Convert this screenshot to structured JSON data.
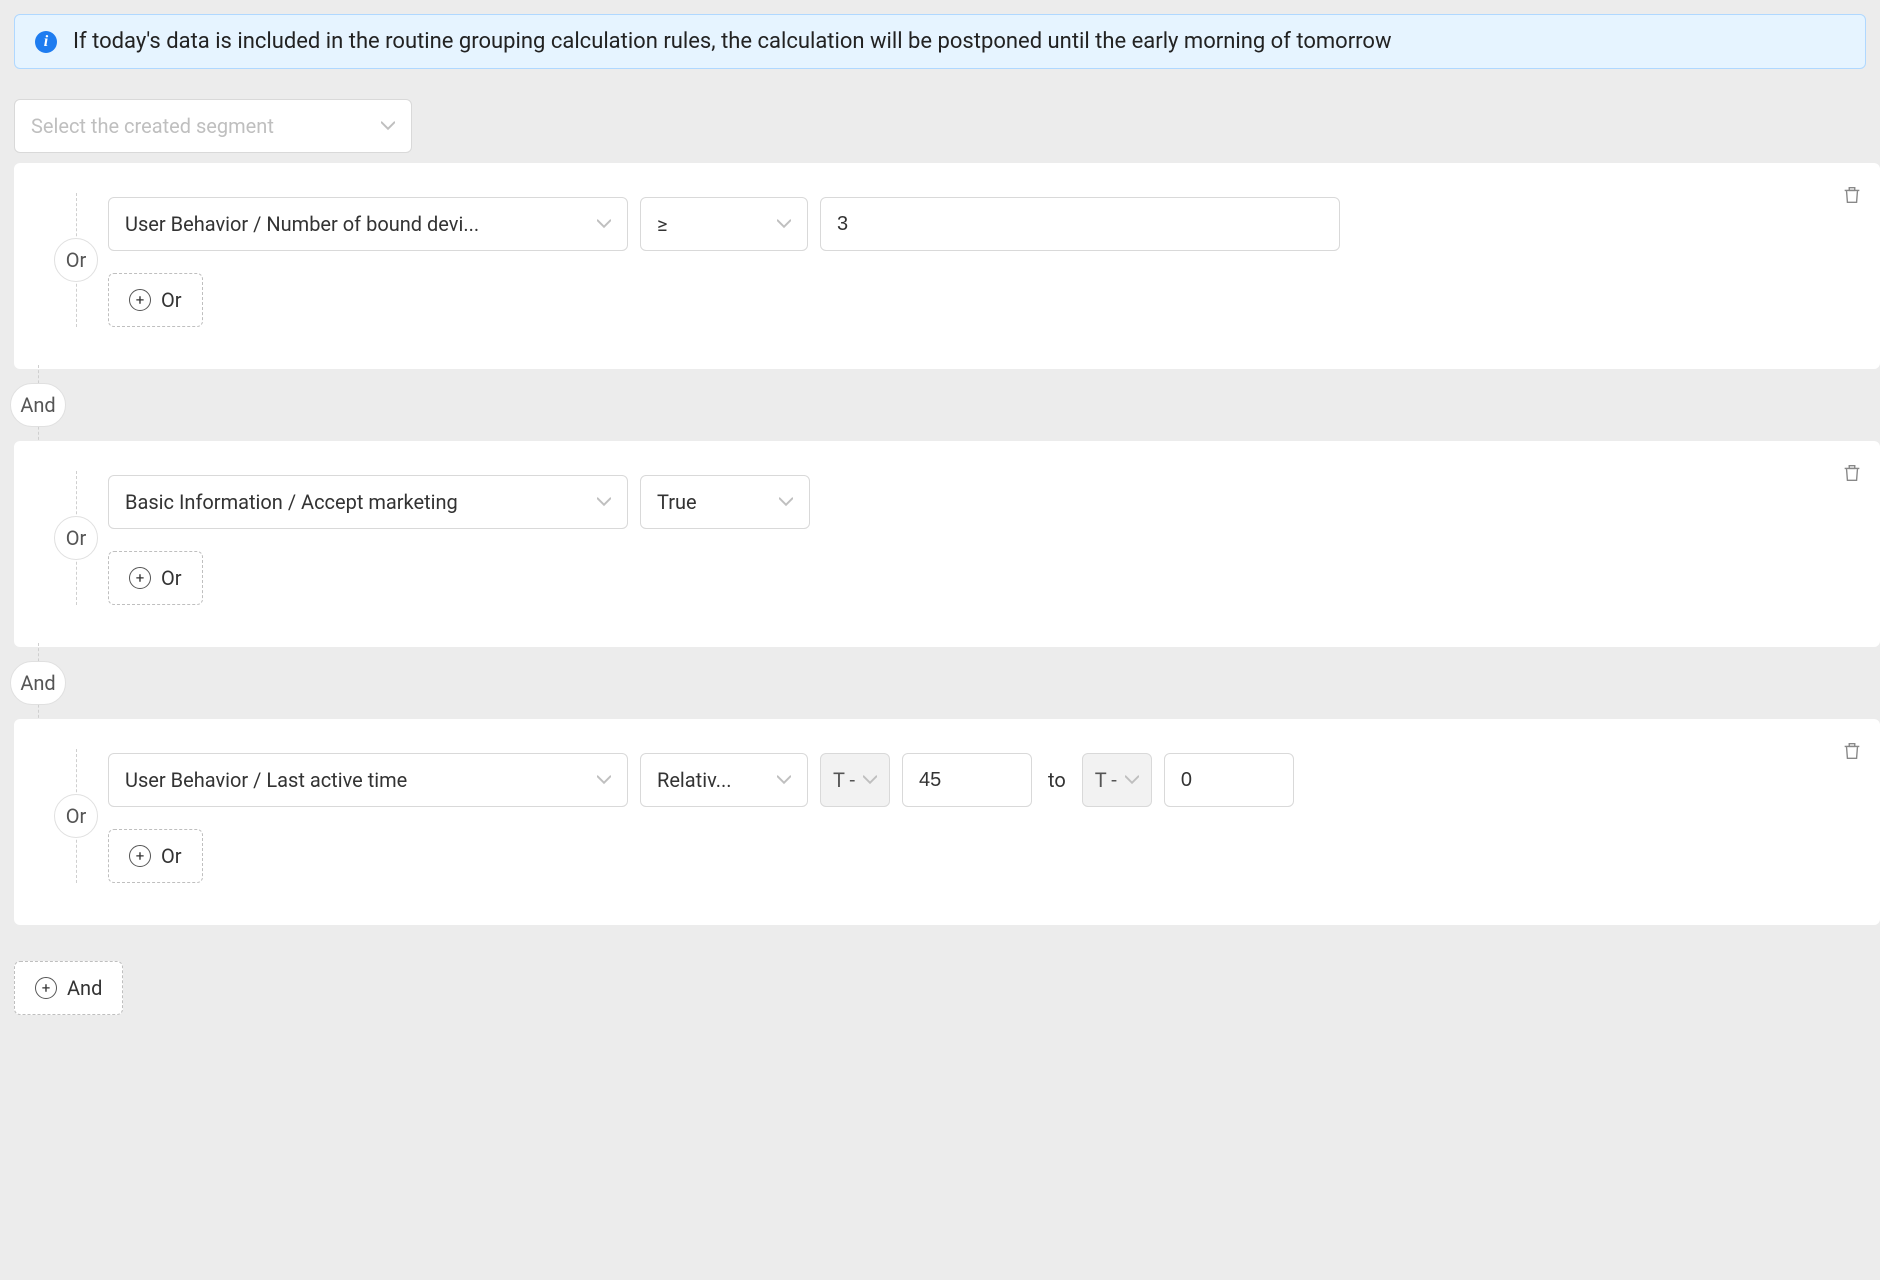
{
  "alert": {
    "text": "If today's data is included in the routine grouping calculation rules, the calculation will be postponed until the early morning of tomorrow"
  },
  "segment_select": {
    "placeholder": "Select the created segment"
  },
  "operators": {
    "or": "Or",
    "and": "And"
  },
  "buttons": {
    "add_or": "Or",
    "add_and": "And"
  },
  "groups": [
    {
      "conditions": [
        {
          "attribute": "User Behavior / Number of bound devi...",
          "comparator": "≥",
          "value": "3"
        }
      ]
    },
    {
      "conditions": [
        {
          "attribute": "Basic Information / Accept marketing",
          "bool_value": "True"
        }
      ]
    },
    {
      "conditions": [
        {
          "attribute": "User Behavior / Last active time",
          "mode": "Relativ...",
          "from_prefix": "T -",
          "from_value": "45",
          "to_label": "to",
          "to_prefix": "T -",
          "to_value": "0"
        }
      ]
    }
  ]
}
